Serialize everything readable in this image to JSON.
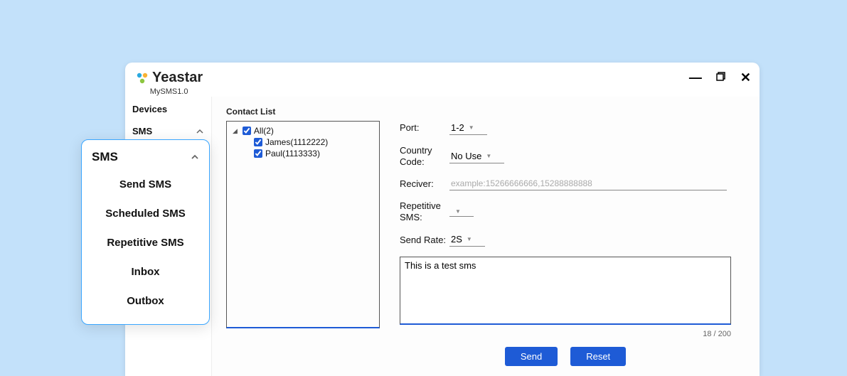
{
  "brand": {
    "name": "Yeastar",
    "sub": "MySMS1.0"
  },
  "nav": {
    "devices": "Devices",
    "sms": "SMS"
  },
  "submenu": {
    "title": "SMS",
    "items": [
      "Send SMS",
      "Scheduled SMS",
      "Repetitive SMS",
      "Inbox",
      "Outbox"
    ]
  },
  "content": {
    "contact_list_title": "Contact List",
    "tree": {
      "root": "All(2)",
      "children": [
        "James(1112222)",
        "Paul(1113333)"
      ]
    },
    "form": {
      "port_label": "Port:",
      "port_value": "1-2",
      "country_label": "Country Code:",
      "country_value": "No Use",
      "receiver_label": "Reciver:",
      "receiver_placeholder": "example:15266666666,15288888888",
      "receiver_value": "",
      "repetitive_label": "Repetitive SMS:",
      "repetitive_value": "",
      "rate_label": "Send Rate:",
      "rate_value": "2S",
      "message": "This is a test sms",
      "char_count": "18 / 200"
    },
    "buttons": {
      "send": "Send",
      "reset": "Reset"
    }
  }
}
